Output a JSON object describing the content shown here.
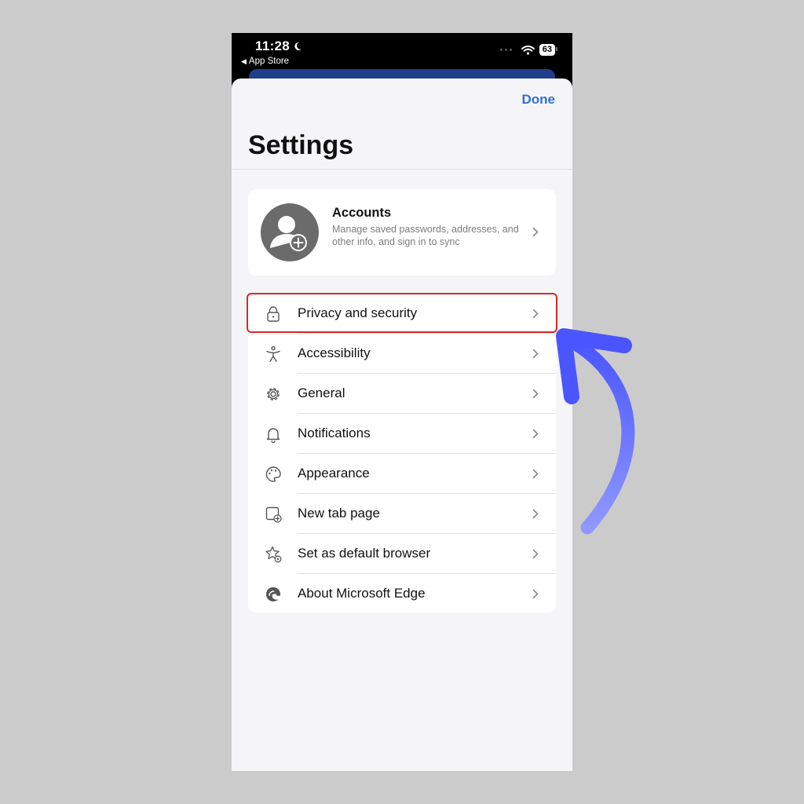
{
  "status_bar": {
    "time": "11:28",
    "back_label": "App Store",
    "battery": "63"
  },
  "header": {
    "done_label": "Done",
    "title": "Settings"
  },
  "accounts": {
    "title": "Accounts",
    "description": "Manage saved passwords, addresses, and other info, and sign in to sync"
  },
  "settings_items": [
    {
      "label": "Privacy and security",
      "icon": "lock-icon",
      "highlighted": true
    },
    {
      "label": "Accessibility",
      "icon": "accessibility-icon"
    },
    {
      "label": "General",
      "icon": "gear-icon"
    },
    {
      "label": "Notifications",
      "icon": "bell-icon"
    },
    {
      "label": "Appearance",
      "icon": "palette-icon"
    },
    {
      "label": "New tab page",
      "icon": "new-tab-icon"
    },
    {
      "label": "Set as default browser",
      "icon": "star-gear-icon"
    },
    {
      "label": "About Microsoft Edge",
      "icon": "edge-logo-icon"
    }
  ],
  "colors": {
    "accent": "#2f6fd6",
    "highlight_border": "#d82828",
    "arrow": "#6f7bff"
  }
}
